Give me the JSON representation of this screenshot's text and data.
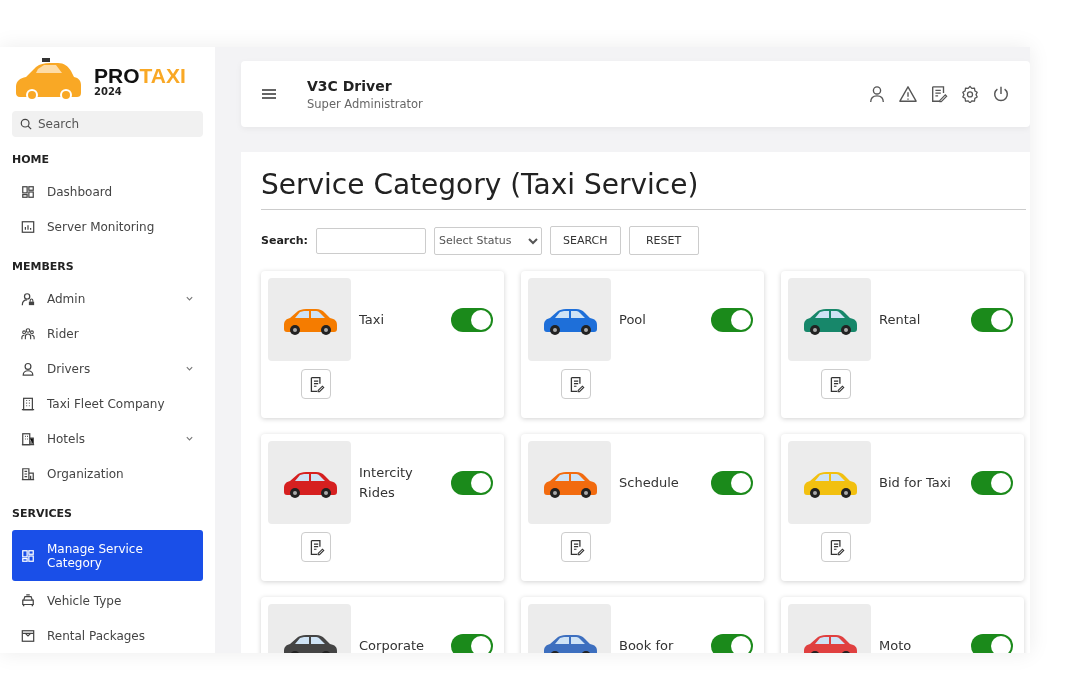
{
  "brand": {
    "name_dark": "PRO",
    "name_accent": "TAXI",
    "year": "2024"
  },
  "sidebar": {
    "search_placeholder": "Search",
    "sections": [
      {
        "heading": "HOME",
        "items": [
          {
            "label": "Dashboard",
            "kind": "grid",
            "expandable": false,
            "selected": false
          },
          {
            "label": "Server Monitoring",
            "kind": "chart",
            "expandable": false,
            "selected": false
          }
        ]
      },
      {
        "heading": "MEMBERS",
        "items": [
          {
            "label": "Admin",
            "kind": "userlock",
            "expandable": true,
            "selected": false
          },
          {
            "label": "Rider",
            "kind": "group",
            "expandable": false,
            "selected": false
          },
          {
            "label": "Drivers",
            "kind": "user",
            "expandable": true,
            "selected": false
          },
          {
            "label": "Taxi Fleet Company",
            "kind": "building",
            "expandable": false,
            "selected": false
          },
          {
            "label": "Hotels",
            "kind": "hotel",
            "expandable": true,
            "selected": false
          },
          {
            "label": "Organization",
            "kind": "office",
            "expandable": false,
            "selected": false
          }
        ]
      },
      {
        "heading": "SERVICES",
        "items": [
          {
            "label": "Manage Service Category",
            "kind": "grid",
            "expandable": false,
            "selected": true
          },
          {
            "label": "Vehicle Type",
            "kind": "car",
            "expandable": false,
            "selected": false
          },
          {
            "label": "Rental Packages",
            "kind": "package",
            "expandable": false,
            "selected": false
          }
        ]
      }
    ]
  },
  "header": {
    "title": "V3C Driver",
    "subtitle": "Super Administrator"
  },
  "page": {
    "title": "Service Category (Taxi Service)",
    "search_label": "Search:",
    "status_placeholder": "Select Status",
    "buttons": [
      "SEARCH",
      "RESET"
    ]
  },
  "categories": [
    {
      "name": "Taxi",
      "on": true,
      "color": "#f57c00"
    },
    {
      "name": "Pool",
      "on": true,
      "color": "#1e6fd9"
    },
    {
      "name": "Rental",
      "on": true,
      "color": "#17876a"
    },
    {
      "name": "Intercity Rides",
      "on": true,
      "color": "#d62020"
    },
    {
      "name": "Schedule",
      "on": true,
      "color": "#f26b0f"
    },
    {
      "name": "Bid for Taxi",
      "on": true,
      "color": "#f2c010"
    },
    {
      "name": "Corporate",
      "on": true,
      "color": "#444444"
    },
    {
      "name": "Book for",
      "on": true,
      "color": "#3d6fbf"
    },
    {
      "name": "Moto",
      "on": true,
      "color": "#e04040"
    }
  ]
}
